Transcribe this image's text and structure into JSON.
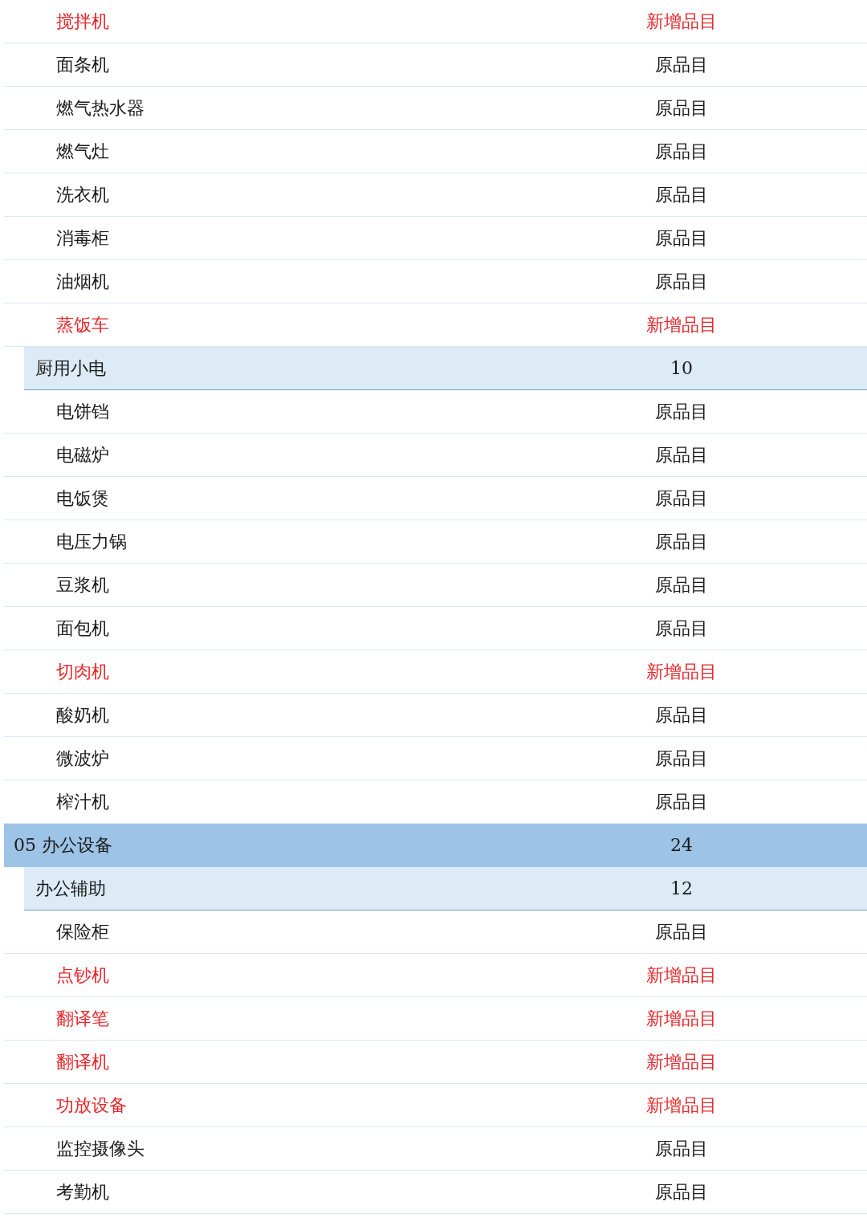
{
  "rows": [
    {
      "kind": "item",
      "label": "搅拌机",
      "value": "新增品目",
      "new": true
    },
    {
      "kind": "item",
      "label": "面条机",
      "value": "原品目",
      "new": false
    },
    {
      "kind": "item",
      "label": "燃气热水器",
      "value": "原品目",
      "new": false
    },
    {
      "kind": "item",
      "label": "燃气灶",
      "value": "原品目",
      "new": false
    },
    {
      "kind": "item",
      "label": "洗衣机",
      "value": "原品目",
      "new": false
    },
    {
      "kind": "item",
      "label": "消毒柜",
      "value": "原品目",
      "new": false
    },
    {
      "kind": "item",
      "label": "油烟机",
      "value": "原品目",
      "new": false
    },
    {
      "kind": "item",
      "label": "蒸饭车",
      "value": "新增品目",
      "new": true
    },
    {
      "kind": "subcategory",
      "label": "厨用小电",
      "value": "10"
    },
    {
      "kind": "item",
      "label": "电饼铛",
      "value": "原品目",
      "new": false
    },
    {
      "kind": "item",
      "label": "电磁炉",
      "value": "原品目",
      "new": false
    },
    {
      "kind": "item",
      "label": "电饭煲",
      "value": "原品目",
      "new": false
    },
    {
      "kind": "item",
      "label": "电压力锅",
      "value": "原品目",
      "new": false
    },
    {
      "kind": "item",
      "label": "豆浆机",
      "value": "原品目",
      "new": false
    },
    {
      "kind": "item",
      "label": "面包机",
      "value": "原品目",
      "new": false
    },
    {
      "kind": "item",
      "label": "切肉机",
      "value": "新增品目",
      "new": true
    },
    {
      "kind": "item",
      "label": "酸奶机",
      "value": "原品目",
      "new": false
    },
    {
      "kind": "item",
      "label": "微波炉",
      "value": "原品目",
      "new": false
    },
    {
      "kind": "item",
      "label": "榨汁机",
      "value": "原品目",
      "new": false
    },
    {
      "kind": "category",
      "label": "05 办公设备",
      "value": "24"
    },
    {
      "kind": "subcategory",
      "label": "办公辅助",
      "value": "12"
    },
    {
      "kind": "item",
      "label": "保险柜",
      "value": "原品目",
      "new": false
    },
    {
      "kind": "item",
      "label": "点钞机",
      "value": "新增品目",
      "new": true
    },
    {
      "kind": "item",
      "label": "翻译笔",
      "value": "新增品目",
      "new": true
    },
    {
      "kind": "item",
      "label": "翻译机",
      "value": "新增品目",
      "new": true
    },
    {
      "kind": "item",
      "label": "功放设备",
      "value": "新增品目",
      "new": true
    },
    {
      "kind": "item",
      "label": "监控摄像头",
      "value": "原品目",
      "new": false
    },
    {
      "kind": "item",
      "label": "考勤机",
      "value": "原品目",
      "new": false
    }
  ]
}
